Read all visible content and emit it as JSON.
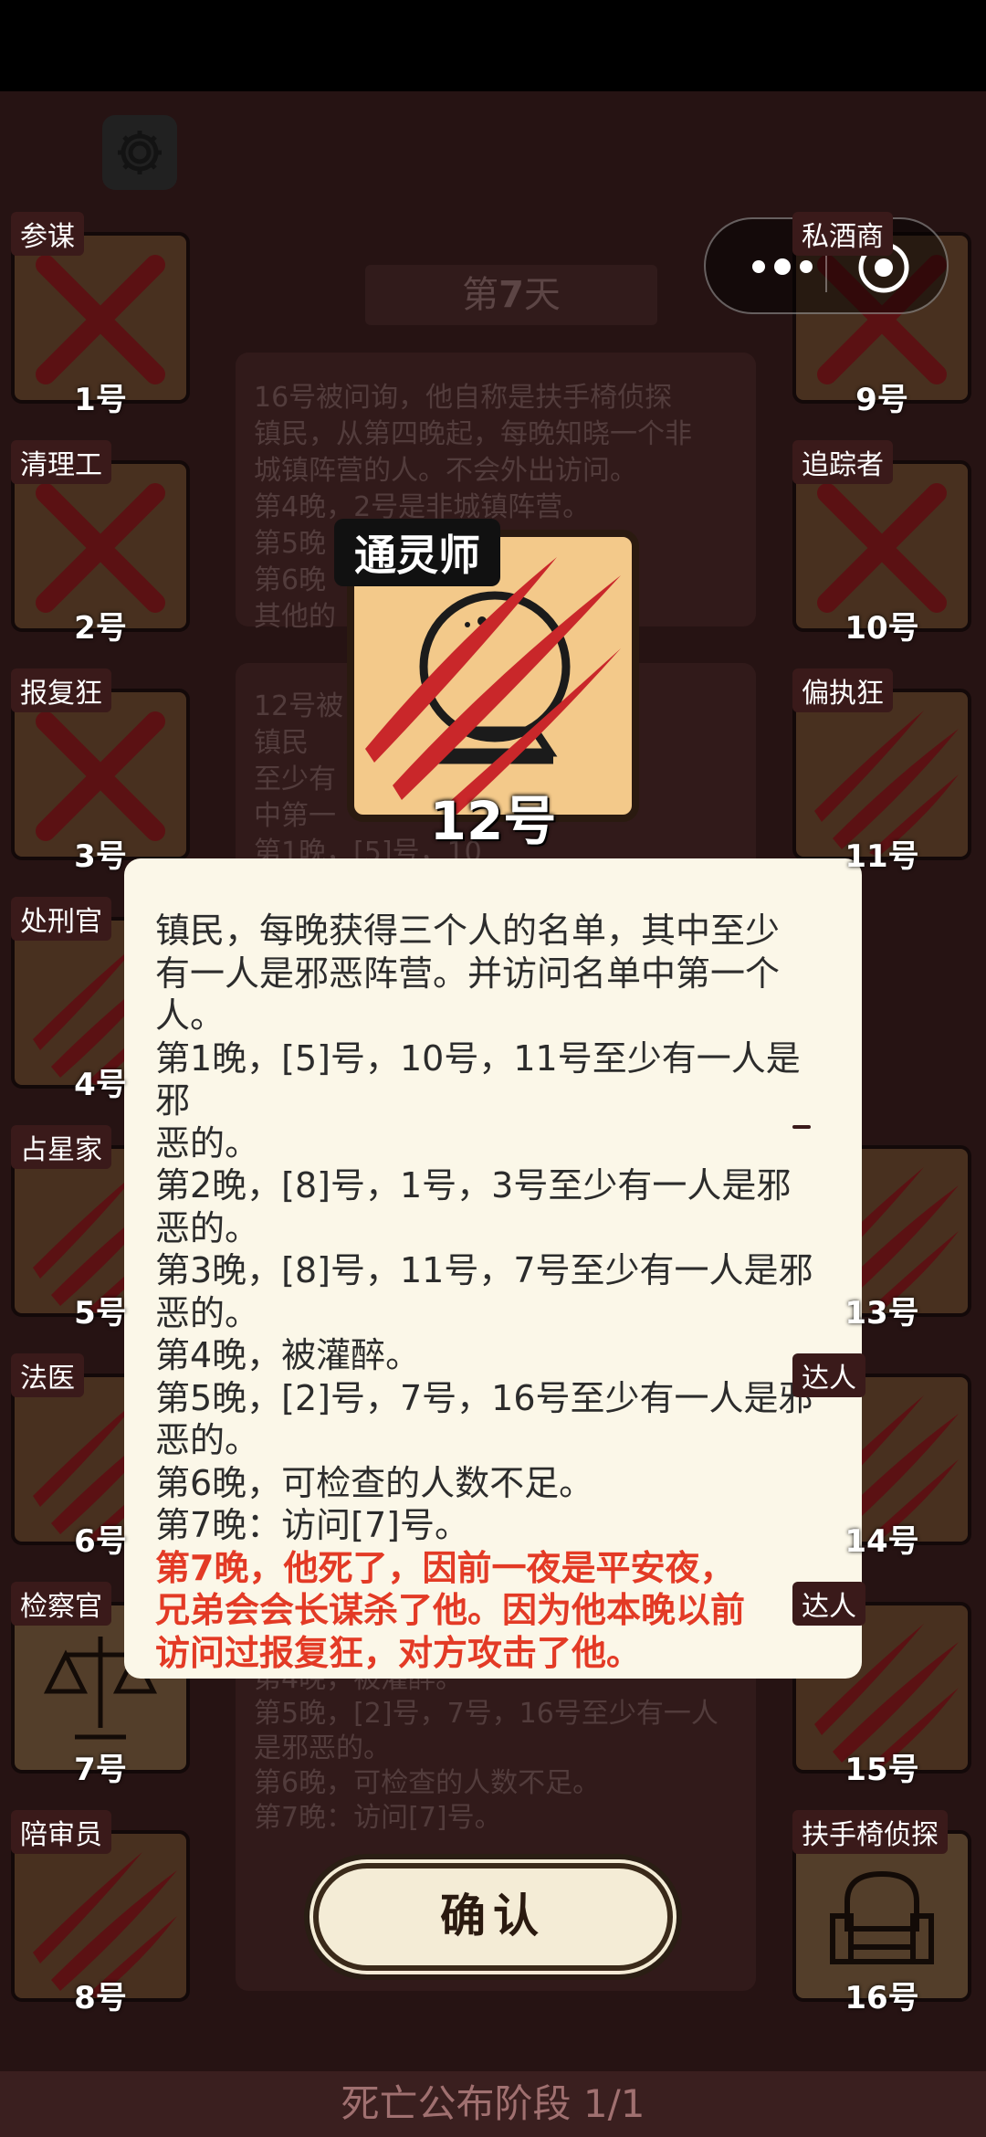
{
  "day": {
    "prefix": "第",
    "number": "7",
    "suffix": "天"
  },
  "players": [
    {
      "num": "1号",
      "role": "参谋",
      "dead": "x"
    },
    {
      "num": "2号",
      "role": "清理工",
      "dead": "x"
    },
    {
      "num": "3号",
      "role": "报复狂",
      "dead": "x"
    },
    {
      "num": "4号",
      "role": "处刑官",
      "dead": "claw"
    },
    {
      "num": "5号",
      "role": "占星家",
      "dead": "claw"
    },
    {
      "num": "6号",
      "role": "法医",
      "dead": "claw"
    },
    {
      "num": "7号",
      "role": "检察官",
      "dead": "none"
    },
    {
      "num": "8号",
      "role": "陪审员",
      "dead": "claw"
    },
    {
      "num": "9号",
      "role": "私酒商",
      "dead": "x"
    },
    {
      "num": "10号",
      "role": "追踪者",
      "dead": "x"
    },
    {
      "num": "11号",
      "role": "偏执狂",
      "dead": "claw"
    },
    {
      "num": "13号",
      "role": "",
      "dead": "claw"
    },
    {
      "num": "14号",
      "role": "达人",
      "dead": "claw"
    },
    {
      "num": "15号",
      "role": "达人",
      "dead": "claw"
    },
    {
      "num": "16号",
      "role": "扶手椅侦探",
      "dead": "none"
    }
  ],
  "background_log": {
    "entry1": [
      "16号被问询，他自称是扶手椅侦探",
      "镇民，从第四晚起，每晚知晓一个非",
      "城镇阵营的人。不会外出访问。",
      "第4晚，2号是非城镇阵营。",
      "第5晚",
      "第6晚",
      "其他的"
    ],
    "entry2": [
      "12号被",
      "镇民",
      "至少有",
      "中第一",
      "第1晚，[5]号，10",
      "11号至少有一人"
    ],
    "entry3": [
      "第4晚，被灌醉。",
      "第5晚，[2]号，7号，16号至少有一人",
      "是邪恶的。",
      "第6晚，可检查的人数不足。",
      "第7晚：访问[7]号。"
    ]
  },
  "focused_card": {
    "role": "通灵师",
    "num": "12号"
  },
  "popup": {
    "lines": [
      "镇民，每晚获得三个人的名单，其中至少",
      "有一人是邪恶阵营。并访问名单中第一个",
      "人。",
      "第1晚，[5]号，10号，11号至少有一人是邪",
      "恶的。",
      "第2晚，[8]号，1号，3号至少有一人是邪",
      "恶的。",
      "第3晚，[8]号，11号，7号至少有一人是邪",
      "恶的。",
      "第4晚，被灌醉。",
      "第5晚，[2]号，7号，16号至少有一人是邪",
      "恶的。",
      "第6晚，可检查的人数不足。",
      "第7晚：访问[7]号。"
    ],
    "red_lines": [
      "第7晚，他死了，因前一夜是平安夜，",
      "兄弟会会长谋杀了他。因为他本晚以前",
      "访问过报复狂，对方攻击了他。"
    ]
  },
  "confirm_label": "确认",
  "phase_label": "死亡公布阶段 1/1",
  "colors": {
    "accent_red": "#e33a25",
    "popup_bg": "#fbf7e8",
    "board_bg": "#542a2b"
  },
  "icons": [
    "gear-icon",
    "crystal-ball-icon",
    "claw-marks-icon",
    "x-mark-icon",
    "armchair-icon",
    "scales-icon",
    "more-dots-icon",
    "close-circle-icon"
  ]
}
